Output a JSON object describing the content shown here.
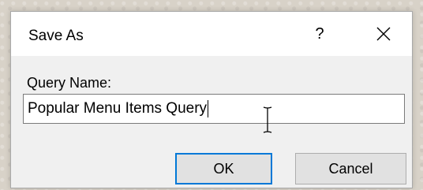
{
  "dialog": {
    "title": "Save As",
    "help_label": "?",
    "close_icon": "close-icon"
  },
  "form": {
    "label": "Query Name:",
    "value": "Popular Menu Items Query"
  },
  "buttons": {
    "ok_label": "OK",
    "cancel_label": "Cancel"
  },
  "colors": {
    "accent": "#0078d7",
    "dialog_bg": "#f0f0f0",
    "titlebar_bg": "#ffffff"
  }
}
